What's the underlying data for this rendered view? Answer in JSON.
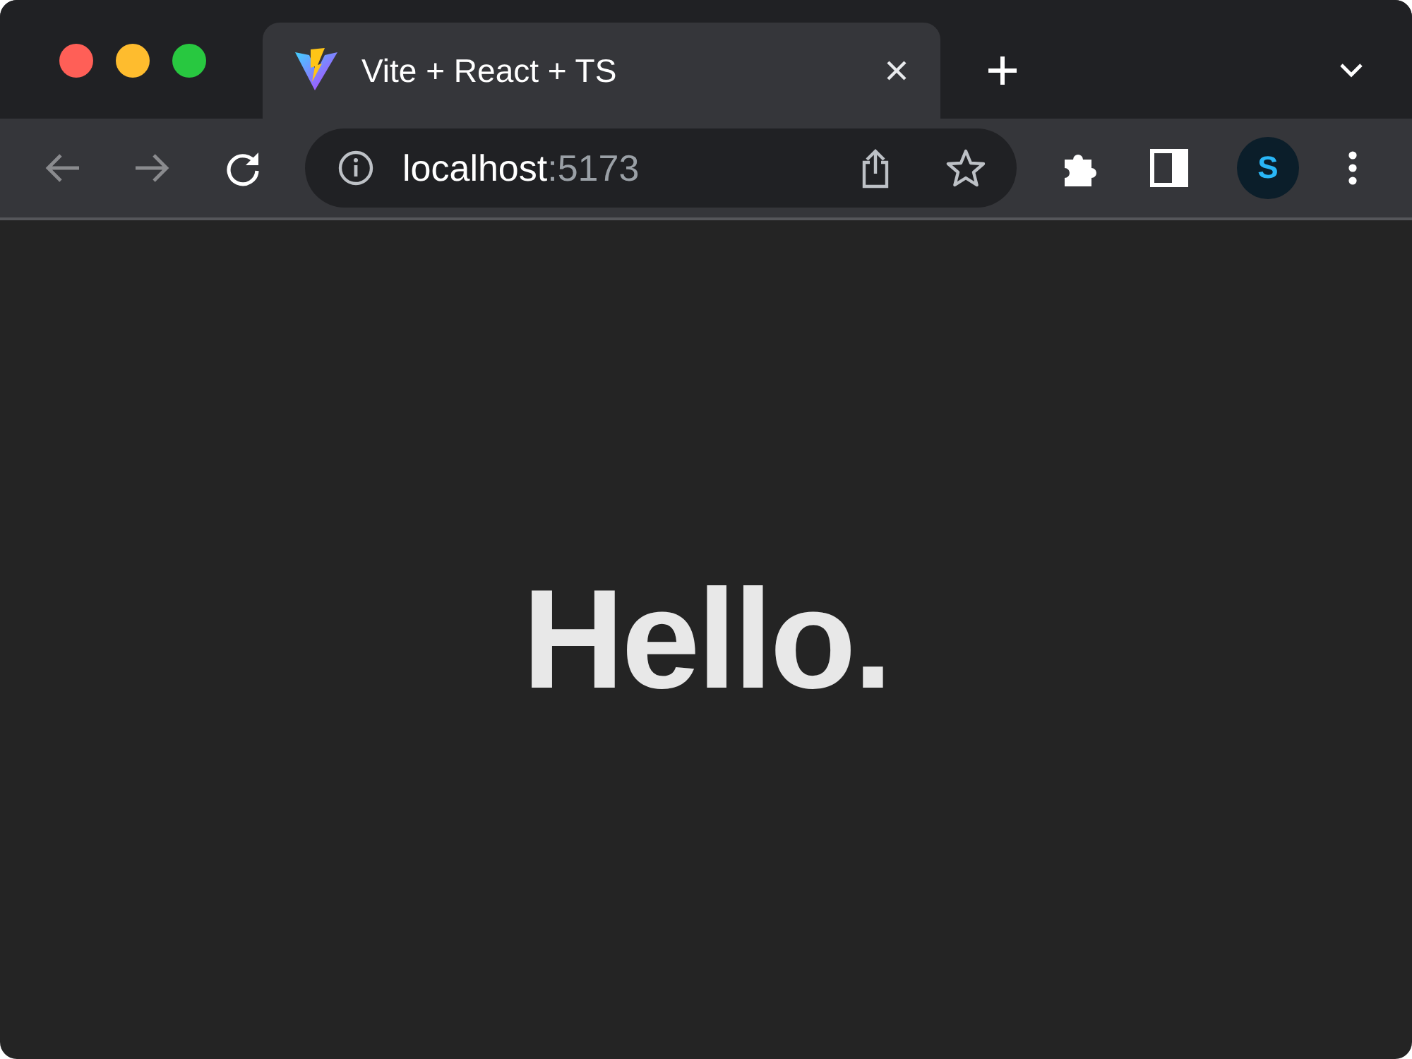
{
  "window": {
    "controls": [
      {
        "color": "#ff5f57"
      },
      {
        "color": "#febc2e"
      },
      {
        "color": "#28c840"
      }
    ]
  },
  "tabs": [
    {
      "title": "Vite + React + TS",
      "selected": true
    }
  ],
  "toolbar": {
    "nav": [
      {
        "kind": "back",
        "disabled": true
      },
      {
        "kind": "forward",
        "disabled": true
      },
      {
        "kind": "reload",
        "disabled": false
      }
    ],
    "address": {
      "host": "localhost",
      "port": ":5173"
    },
    "profile": {
      "initial": "S"
    }
  },
  "page": {
    "heading": "Hello."
  }
}
